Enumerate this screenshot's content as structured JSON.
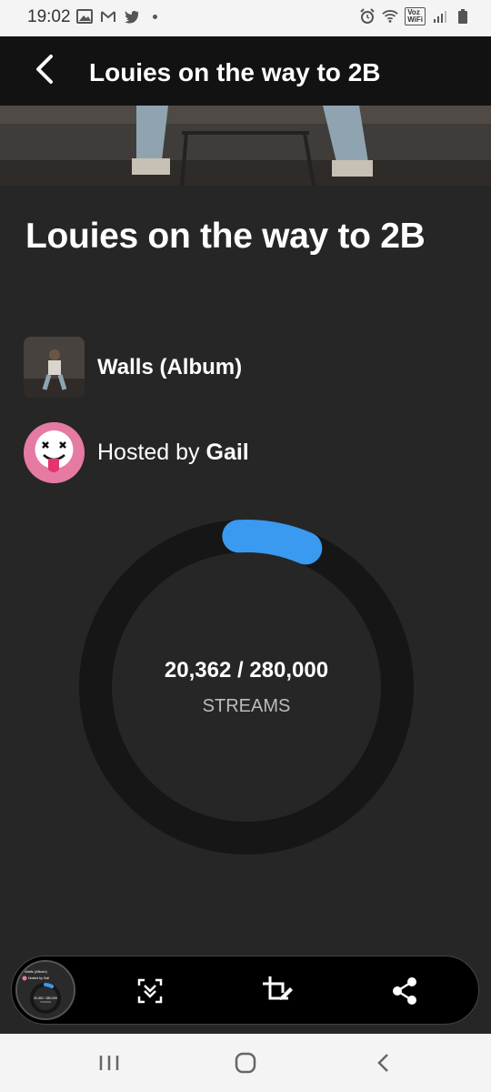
{
  "status_bar": {
    "time": "19:02",
    "left_icons": [
      "image-icon",
      "gmail-icon",
      "twitter-icon",
      "dot-icon"
    ],
    "right_icons": [
      "alarm-icon",
      "wifi-icon",
      "volte-icon",
      "signal-icon",
      "battery-icon"
    ],
    "volte_label": "Voz\nWiFi"
  },
  "app_bar": {
    "back_icon": "arrow-left-icon",
    "title": "Louies on the way to 2B"
  },
  "page": {
    "title": "Louies on the way to 2B",
    "album_label": "Walls (Album)",
    "host_prefix": "Hosted by",
    "host_name": "Gail"
  },
  "progress": {
    "current": "20,362",
    "goal": "280,000",
    "separator": "/",
    "label": "STREAMS",
    "fraction": 0.0727,
    "colors": {
      "track": "#161616",
      "fill": "#3a9af0"
    }
  },
  "toolbar": {
    "buttons": [
      "scroll-capture-icon",
      "crop-edit-icon",
      "share-icon"
    ],
    "preview": {
      "album_label": "Walls (Album)",
      "host_text": "Hosted by Gail",
      "count": "20,362 / 280,000",
      "label": "STREAMS"
    }
  },
  "nav_bar": {
    "buttons": [
      "recent-apps-icon",
      "home-icon",
      "back-icon"
    ]
  }
}
